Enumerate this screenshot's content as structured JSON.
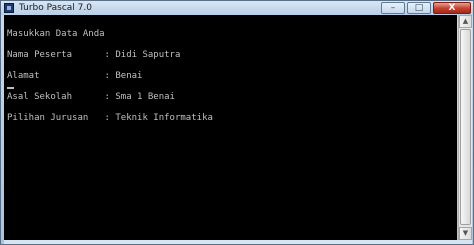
{
  "window": {
    "title": "Turbo Pascal 7.0",
    "controls": {
      "minimize": "–",
      "maximize": "□",
      "close": "X"
    }
  },
  "console": {
    "lines": [
      "Masukkan Data Anda",
      "Nama Peserta      : Didi Saputra",
      "Alamat            : Benai",
      "Asal Sekolah      : Sma 1 Benai",
      "Pilihan Jurusan   : Teknik Informatika"
    ]
  },
  "scrollbar": {
    "up": "▲",
    "down": "▼"
  }
}
